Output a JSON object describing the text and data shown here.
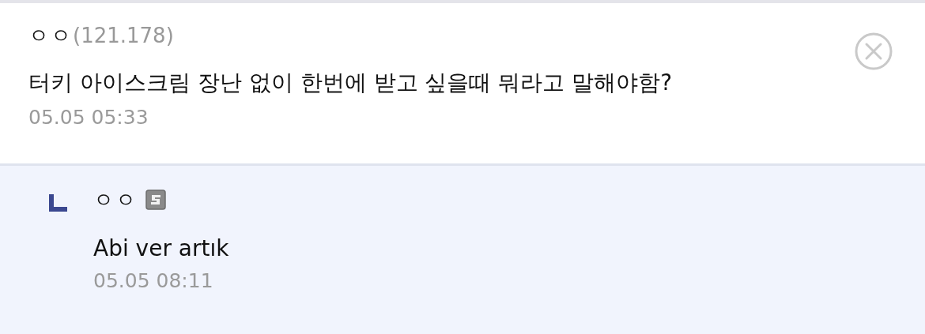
{
  "comment": {
    "nickname": "ㅇㅇ",
    "ip": "(121.178)",
    "body": "터키 아이스크림 장난 없이 한번에 받고 싶을때 뭐라고 말해야함?",
    "date": "05.05 05:33"
  },
  "replies": [
    {
      "nickname": "ㅇㅇ",
      "body": "Abi ver artık",
      "date": "05.05 08:11"
    }
  ]
}
